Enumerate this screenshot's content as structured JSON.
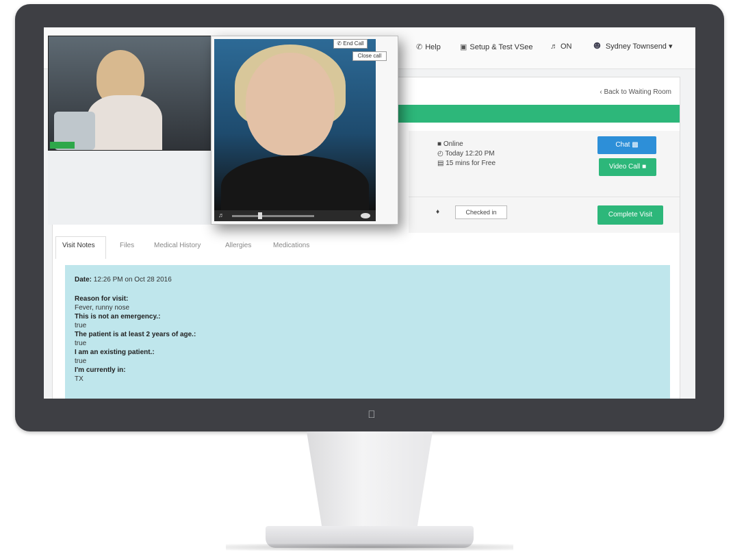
{
  "topnav": {
    "help": "Help",
    "setup": "Setup & Test VSee",
    "sound": "ON",
    "user": "Sydney Townsend"
  },
  "page": {
    "back_link": "Back to Waiting Room"
  },
  "visit_info": {
    "status": "Online",
    "time": "Today 12:20 PM",
    "duration": "15 mins for Free",
    "chat_label": "Chat",
    "video_call_label": "Video Call",
    "checked_in_label": "Checked in",
    "complete_label": "Complete Visit"
  },
  "tabs": [
    "Visit Notes",
    "Files",
    "Medical History",
    "Allergies",
    "Medications"
  ],
  "notes": {
    "date_label": "Date:",
    "date_value": "12:26 PM on Oct 28 2016",
    "reason_label": "Reason for visit:",
    "reason_value": "Fever, runny nose",
    "q1_label": "This is not an emergency.:",
    "q1_value": "true",
    "q2_label": "The patient is at least 2 years of age.:",
    "q2_value": "true",
    "q3_label": "I am an existing patient.:",
    "q3_value": "true",
    "q4_label": "I'm currently in:",
    "q4_value": "TX"
  },
  "video_call": {
    "end_call_label": "End Call",
    "close_call_label": "Close call"
  },
  "colors": {
    "green": "#2db77a",
    "blue": "#2d8fd8",
    "notes_bg": "#bfe6ec",
    "bezel": "#3e3f44"
  }
}
